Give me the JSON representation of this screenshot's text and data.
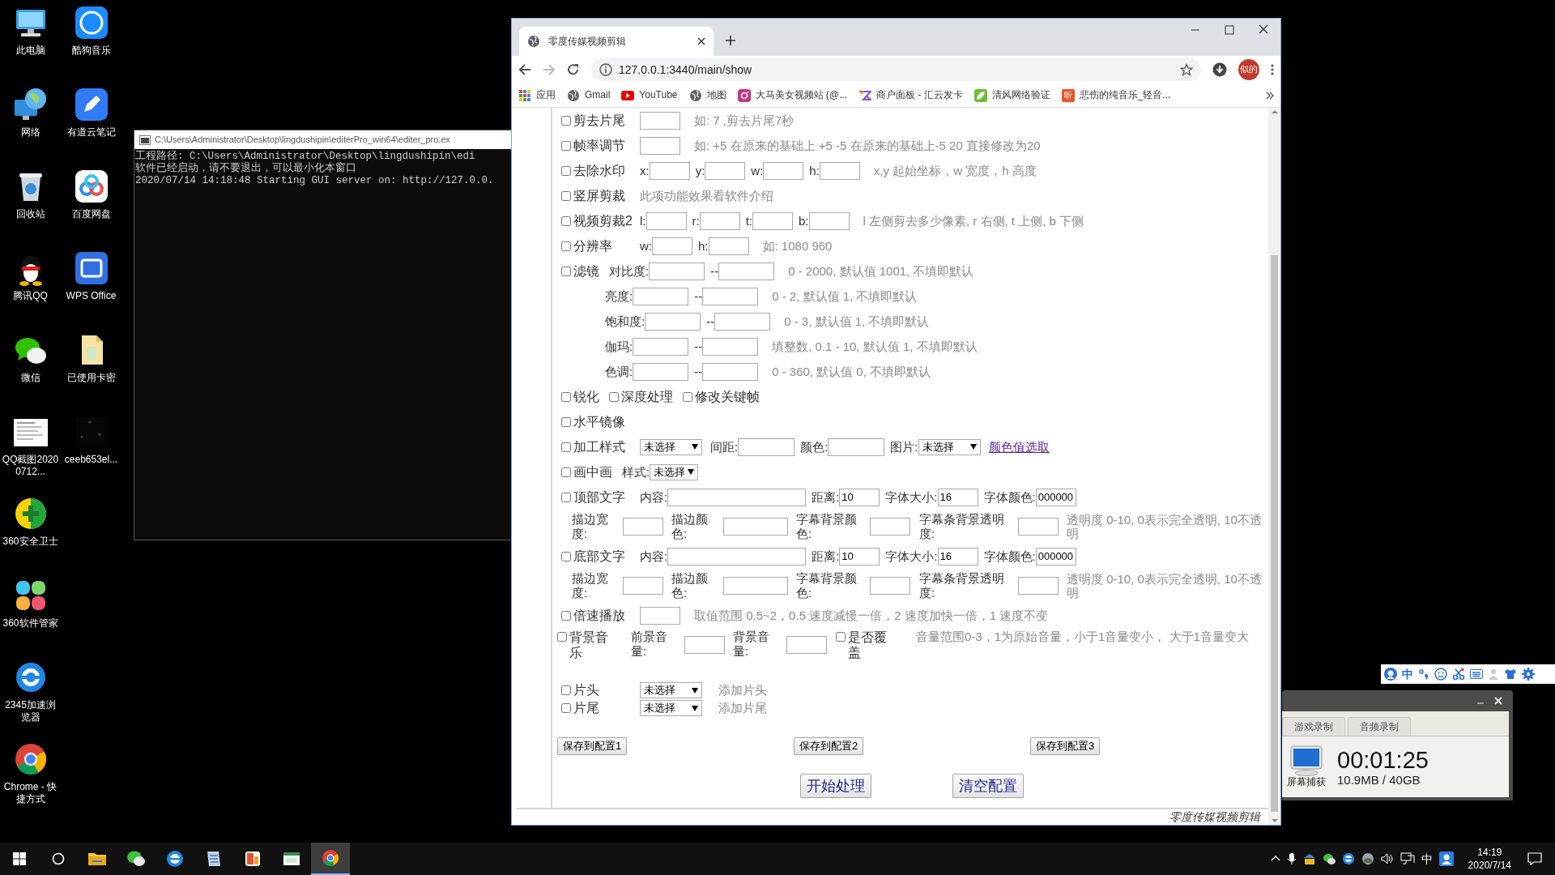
{
  "desktop": {
    "icons": [
      {
        "label": "此电脑"
      },
      {
        "label": "网络"
      },
      {
        "label": "回收站"
      },
      {
        "label": "腾讯QQ"
      },
      {
        "label": "微信"
      },
      {
        "label": "QQ截图20200712..."
      },
      {
        "label": "360安全卫士"
      },
      {
        "label": "360软件管家"
      },
      {
        "label": "2345加速浏览器"
      },
      {
        "label": "Chrome - 快捷方式"
      },
      {
        "label": "酷狗音乐"
      },
      {
        "label": "有道云笔记"
      },
      {
        "label": "百度网盘"
      },
      {
        "label": "WPS Office"
      },
      {
        "label": "已使用卡密"
      },
      {
        "label": "ceeb653el..."
      }
    ]
  },
  "console": {
    "title": "C:\\Users\\Administrator\\Desktop\\lingdushipin\\editerPro_win64\\editer_pro.ex",
    "lines": [
      "工程路径:  C:\\Users\\Administrator\\Desktop\\lingdushipin\\edi",
      "软件已经启动，请不要退出，可以最小化本窗口",
      "2020/07/14 14:18:48 Starting GUI server on: http://127.0.0."
    ]
  },
  "browser": {
    "tab": {
      "title": "零度传媒视频剪辑"
    },
    "url": "127.0.0.1:3440/main/show",
    "profile": "似的",
    "bookmarks": [
      {
        "label": "应用"
      },
      {
        "label": "Gmail"
      },
      {
        "label": "YouTube"
      },
      {
        "label": "地图"
      },
      {
        "label": "大马美女视频站 (@..."
      },
      {
        "label": "商户面板 - 汇云发卡"
      },
      {
        "label": "清风网络验证"
      },
      {
        "label": "悲伤的纯音乐_轻音...",
        "badge": "听"
      }
    ],
    "form": {
      "rows": [
        {
          "kind": "line",
          "items": [
            {
              "kind": "check",
              "label": "剪去片尾",
              "checked": false
            },
            {
              "kind": "field"
            },
            {
              "kind": "note",
              "text": "如: 7 ,剪去片尾7秒"
            }
          ]
        },
        {
          "kind": "line",
          "items": [
            {
              "kind": "check",
              "label": "帧率调节",
              "checked": false
            },
            {
              "kind": "field"
            },
            {
              "kind": "note",
              "text": "如: +5 在原来的基础上 +5 -5 在原来的基础上-5 20 直接修改为20"
            }
          ]
        },
        {
          "kind": "line",
          "items": [
            {
              "kind": "check",
              "label": "去除水印",
              "checked": false
            },
            {
              "kind": "text",
              "text": "x:"
            },
            {
              "kind": "field"
            },
            {
              "kind": "text",
              "text": "y:"
            },
            {
              "kind": "field"
            },
            {
              "kind": "text",
              "text": "w:"
            },
            {
              "kind": "field"
            },
            {
              "kind": "text",
              "text": "h:"
            },
            {
              "kind": "field"
            },
            {
              "kind": "note",
              "text": "x,y 起始坐标，w 宽度，h 高度"
            }
          ]
        },
        {
          "kind": "line",
          "items": [
            {
              "kind": "check",
              "label": "竖屏剪裁",
              "checked": false
            },
            {
              "kind": "plain-note",
              "text": "此项功能效果看软件介绍"
            }
          ]
        },
        {
          "kind": "line",
          "items": [
            {
              "kind": "check",
              "label": "视频剪裁2",
              "checked": false
            },
            {
              "kind": "text",
              "text": "l:"
            },
            {
              "kind": "field"
            },
            {
              "kind": "text",
              "text": "r:"
            },
            {
              "kind": "field"
            },
            {
              "kind": "text",
              "text": "t:"
            },
            {
              "kind": "field"
            },
            {
              "kind": "text",
              "text": "b:"
            },
            {
              "kind": "field"
            },
            {
              "kind": "note",
              "text": "l 左侧剪去多少像素, r 右侧, t 上侧, b 下侧"
            }
          ]
        },
        {
          "kind": "line",
          "items": [
            {
              "kind": "check",
              "label": "分辨率",
              "checked": false
            },
            {
              "kind": "text",
              "text": "w:"
            },
            {
              "kind": "field"
            },
            {
              "kind": "text",
              "text": "h:"
            },
            {
              "kind": "field"
            },
            {
              "kind": "note",
              "text": "如: 1080 960"
            }
          ]
        },
        {
          "kind": "line",
          "items": [
            {
              "kind": "inline-check",
              "label": "滤镜",
              "checked": false
            },
            {
              "kind": "text",
              "text": "对比度:"
            },
            {
              "kind": "range-field"
            },
            {
              "kind": "text",
              "text": "--"
            },
            {
              "kind": "range-field"
            },
            {
              "kind": "note",
              "text": "0 - 2000, 默认值 1001, 不填即默认"
            }
          ]
        },
        {
          "kind": "indent-line",
          "items": [
            {
              "kind": "text",
              "text": "亮度:"
            },
            {
              "kind": "range-field"
            },
            {
              "kind": "text",
              "text": "--"
            },
            {
              "kind": "range-field"
            },
            {
              "kind": "note",
              "text": "0 - 2, 默认值 1, 不填即默认"
            }
          ]
        },
        {
          "kind": "indent-line",
          "items": [
            {
              "kind": "text",
              "text": "饱和度:"
            },
            {
              "kind": "range-field"
            },
            {
              "kind": "text",
              "text": "--"
            },
            {
              "kind": "range-field"
            },
            {
              "kind": "note",
              "text": "0 - 3, 默认值 1, 不填即默认"
            }
          ]
        },
        {
          "kind": "indent-line",
          "items": [
            {
              "kind": "text",
              "text": "伽玛:"
            },
            {
              "kind": "range-field"
            },
            {
              "kind": "text",
              "text": "--"
            },
            {
              "kind": "range-field"
            },
            {
              "kind": "note",
              "text": "填整数, 0.1 - 10, 默认值 1, 不填即默认"
            }
          ]
        },
        {
          "kind": "indent-line",
          "items": [
            {
              "kind": "text",
              "text": "色调:"
            },
            {
              "kind": "range-field"
            },
            {
              "kind": "text",
              "text": "--"
            },
            {
              "kind": "range-field"
            },
            {
              "kind": "note",
              "text": "0 - 360, 默认值 0, 不填即默认"
            }
          ]
        },
        {
          "kind": "line",
          "items": [
            {
              "kind": "inline-check",
              "label": "锐化",
              "checked": false
            },
            {
              "kind": "inline-check",
              "label": "深度处理",
              "checked": false
            },
            {
              "kind": "inline-check",
              "label": "修改关键帧",
              "checked": false
            }
          ]
        },
        {
          "kind": "line",
          "items": [
            {
              "kind": "check",
              "label": "水平镜像",
              "checked": false
            }
          ]
        },
        {
          "kind": "line",
          "items": [
            {
              "kind": "check",
              "label": "加工样式",
              "checked": false
            },
            {
              "kind": "select",
              "value": "未选择"
            },
            {
              "kind": "text",
              "text": "间距:"
            },
            {
              "kind": "wide-field"
            },
            {
              "kind": "text",
              "text": "颜色:"
            },
            {
              "kind": "wide-field"
            },
            {
              "kind": "text",
              "text": "图片:"
            },
            {
              "kind": "select",
              "value": "未选择"
            },
            {
              "kind": "link",
              "text": "颜色值选取"
            }
          ]
        },
        {
          "kind": "line",
          "items": [
            {
              "kind": "inline-check",
              "label": "画中画",
              "checked": false
            },
            {
              "kind": "text",
              "text": "样式:"
            },
            {
              "kind": "small-select",
              "value": "未选择"
            }
          ]
        },
        {
          "kind": "line",
          "items": [
            {
              "kind": "check",
              "label": "顶部文字",
              "checked": false
            },
            {
              "kind": "text",
              "text": "内容:"
            },
            {
              "kind": "long-field"
            },
            {
              "kind": "text",
              "text": "距离:"
            },
            {
              "kind": "field",
              "value": "10"
            },
            {
              "kind": "text",
              "text": "字体大小:"
            },
            {
              "kind": "field",
              "value": "16"
            },
            {
              "kind": "text",
              "text": "字体颜色:"
            },
            {
              "kind": "field",
              "value": "000000"
            }
          ]
        },
        {
          "kind": "caption-grid",
          "items": [
            {
              "kind": "text",
              "text": "描边宽度:"
            },
            {
              "kind": "field"
            },
            {
              "kind": "text",
              "text": "描边颜色:"
            },
            {
              "kind": "wide-field"
            },
            {
              "kind": "text",
              "text": "字幕背景颜色:"
            },
            {
              "kind": "field"
            },
            {
              "kind": "text",
              "text": "字幕条背景透明度:"
            },
            {
              "kind": "field"
            },
            {
              "kind": "note",
              "text": "透明度 0-10, 0表示完全透明, 10不透明"
            }
          ]
        },
        {
          "kind": "line",
          "items": [
            {
              "kind": "check",
              "label": "底部文字",
              "checked": false
            },
            {
              "kind": "text",
              "text": "内容:"
            },
            {
              "kind": "long-field"
            },
            {
              "kind": "text",
              "text": "距离:"
            },
            {
              "kind": "field",
              "value": "10"
            },
            {
              "kind": "text",
              "text": "字体大小:"
            },
            {
              "kind": "field",
              "value": "16"
            },
            {
              "kind": "text",
              "text": "字体颜色:"
            },
            {
              "kind": "field",
              "value": "000000"
            }
          ]
        },
        {
          "kind": "caption-grid",
          "items": [
            {
              "kind": "text",
              "text": "描边宽度:"
            },
            {
              "kind": "field"
            },
            {
              "kind": "text",
              "text": "描边颜色:"
            },
            {
              "kind": "wide-field"
            },
            {
              "kind": "text",
              "text": "字幕背景颜色:"
            },
            {
              "kind": "field"
            },
            {
              "kind": "text",
              "text": "字幕条背景透明度:"
            },
            {
              "kind": "field"
            },
            {
              "kind": "note",
              "text": "透明度 0-10, 0表示完全透明, 10不透明"
            }
          ]
        },
        {
          "kind": "line",
          "items": [
            {
              "kind": "check",
              "label": "倍速播放",
              "checked": false
            },
            {
              "kind": "field"
            },
            {
              "kind": "note",
              "text": "取值范围 0.5~2，0.5 速度减慢一倍，2 速度加快一倍，1 速度不变"
            }
          ]
        },
        {
          "kind": "music-grid",
          "items": [
            {
              "kind": "check",
              "label": "背景音乐",
              "checked": false
            },
            {
              "kind": "text",
              "text": "前景音量:"
            },
            {
              "kind": "field"
            },
            {
              "kind": "text",
              "text": "背景音量:"
            },
            {
              "kind": "field"
            },
            {
              "kind": "check",
              "label": "是否覆盖",
              "checked": false
            },
            {
              "kind": "note",
              "text": "音量范围0-3，1为原始音量，小于1音量变小， 大于1音量变大"
            }
          ]
        },
        {
          "kind": "compact",
          "items": [
            {
              "kind": "check",
              "label": "片头",
              "checked": false
            },
            {
              "kind": "select",
              "value": "未选择"
            },
            {
              "kind": "note",
              "text": "添加片头"
            }
          ]
        },
        {
          "kind": "compact",
          "items": [
            {
              "kind": "check",
              "label": "片尾",
              "checked": false
            },
            {
              "kind": "select",
              "value": "未选择"
            },
            {
              "kind": "note",
              "text": "添加片尾"
            }
          ]
        },
        {
          "kind": "save-buttons",
          "items": [
            {
              "kind": "button",
              "label": "保存到配置1"
            },
            {
              "kind": "button",
              "label": "保存到配置2"
            },
            {
              "kind": "button",
              "label": "保存到配置3"
            }
          ]
        },
        {
          "kind": "actions",
          "items": [
            {
              "kind": "big-button",
              "label": "开始处理"
            },
            {
              "kind": "big-button",
              "label": "清空配置"
            }
          ]
        }
      ]
    },
    "footer": "零度传媒视频剪辑"
  },
  "recorder": {
    "tabs": [
      {
        "label": "游戏录制"
      },
      {
        "label": "音频录制"
      }
    ],
    "mode": "屏幕捕获",
    "elapsed": "00:01:25",
    "size": "10.9MB / 40GB"
  },
  "ime_toolbar": {
    "language": "中"
  },
  "taskbar": {
    "apps": [
      {
        "selected": false
      },
      {
        "selected": false
      },
      {
        "selected": false
      },
      {
        "selected": false
      },
      {
        "selected": false
      },
      {
        "selected": false
      },
      {
        "selected": true
      }
    ],
    "language": "中",
    "time": "14:19",
    "date": "2020/7/14"
  }
}
